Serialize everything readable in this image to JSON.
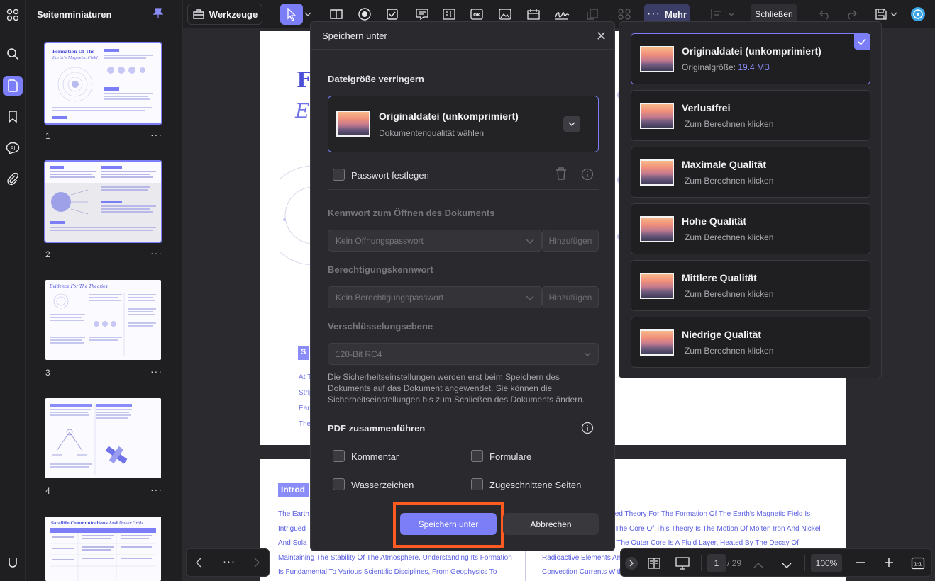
{
  "thumbnails_panel": {
    "title": "Seitenminiaturen",
    "pages": [
      {
        "num": "1",
        "more": "···"
      },
      {
        "num": "2",
        "more": "···"
      },
      {
        "num": "3",
        "more": "···"
      },
      {
        "num": "4",
        "more": "···"
      }
    ]
  },
  "toolbar": {
    "tools_label": "Werkzeuge",
    "more_label": "Mehr",
    "close_label": "Schließen"
  },
  "document": {
    "page1_heading_1": "F",
    "page1_heading_2": "Ea",
    "page1_section": "S",
    "page1_lines": [
      "At T",
      "Strip",
      "Ear",
      "The"
    ],
    "page2_intro": "Introd",
    "page2_left_lines": [
      "The Earth",
      "Intrigued",
      "And Sola",
      "Maintaining The Stability Of The Atmosphere. Understanding Its Formation",
      "Is Fundamental To Various Scientific Disciplines, From Geophysics To"
    ],
    "page2_right_lines": [
      "ted Theory For The Formation Of The Earth's Magnetic Field Is",
      "The Core Of This Theory Is The Motion Of Molten Iron And Nickel",
      ". The Outer Core Is A Fluid Layer, Heated By The Decay Of",
      "Radioactive Elements And",
      "Convection Currents Withi"
    ]
  },
  "dialog": {
    "title": "Speichern unter",
    "reduce_size_label": "Dateigröße verringern",
    "selected_quality": "Originaldatei (unkomprimiert)",
    "selected_quality_sub": "Dokumentenqualität wählen",
    "password_label": "Passwort festlegen",
    "open_pw_label": "Kennwort zum Öffnen des Dokuments",
    "open_pw_value": "Kein Öffnungspasswort",
    "add_label": "Hinzufügen",
    "perm_pw_label": "Berechtigungskennwort",
    "perm_pw_value": "Kein Berechtigungspasswort",
    "encryption_label": "Verschlüsselungsebene",
    "encryption_value": "128-Bit RC4",
    "security_note": "Die Sicherheitseinstellungen werden erst beim Speichern des Dokuments auf das Dokument angewendet. Sie können die Sicherheitseinstellungen bis zum Schließen des Dokuments ändern.",
    "merge_label": "PDF zusammenführen",
    "merge_options": [
      "Kommentar",
      "Formulare",
      "Wasserzeichen",
      "Zugeschnittene Seiten"
    ],
    "save_button": "Speichern unter",
    "cancel_button": "Abbrechen"
  },
  "quality_options": [
    {
      "title": "Originaldatei (unkomprimiert)",
      "sub_prefix": "Originalgröße: ",
      "sub_value": "19.4 MB",
      "selected": true
    },
    {
      "title": "Verlustfrei",
      "sub": "Zum Berechnen klicken"
    },
    {
      "title": "Maximale Qualität",
      "sub": "Zum Berechnen klicken"
    },
    {
      "title": "Hohe Qualität",
      "sub": "Zum Berechnen klicken"
    },
    {
      "title": "Mittlere Qualität",
      "sub": "Zum Berechnen klicken"
    },
    {
      "title": "Niedrige Qualität",
      "sub": "Zum Berechnen klicken"
    }
  ],
  "pagination": {
    "more": "···",
    "current_page": "1",
    "total_pages": "/ 29",
    "zoom": "100%"
  },
  "colors": {
    "accent": "#7b7ef7",
    "highlight": "#ff5a1f"
  }
}
